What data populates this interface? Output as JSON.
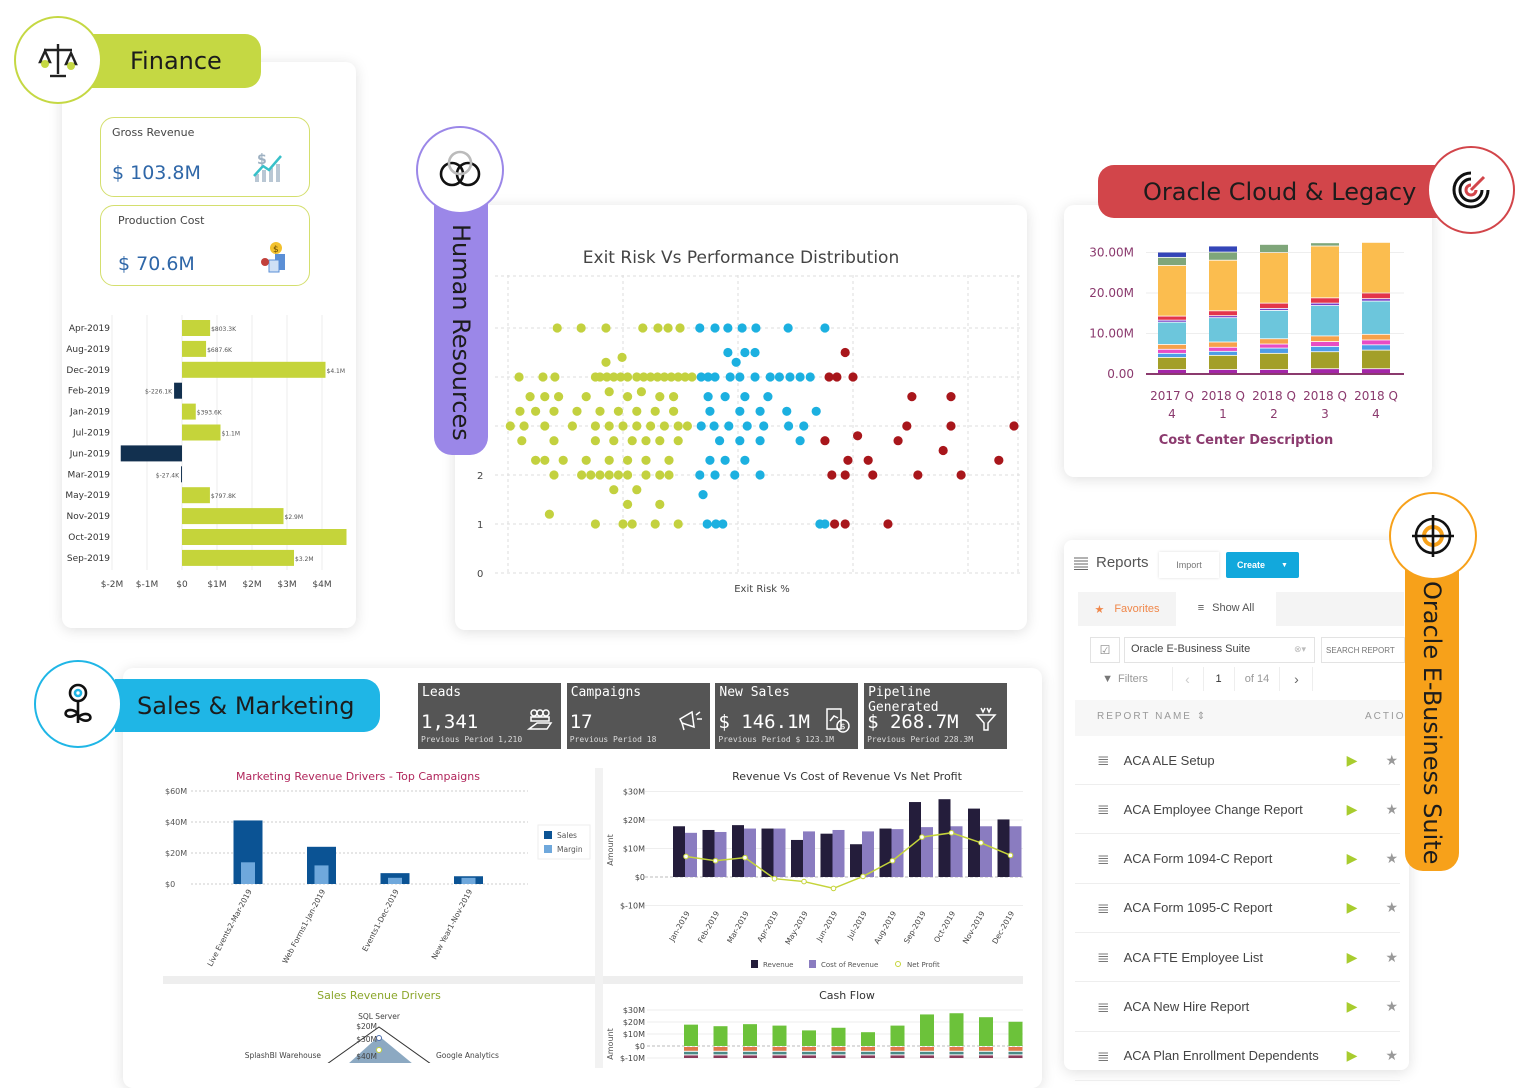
{
  "colors": {
    "finance": "#c5d843",
    "hr": "#9b87e8",
    "oracle_cloud": "#d2454a",
    "ebs": "#f7a11a",
    "sales": "#1fb6e6"
  },
  "finance": {
    "title": "Finance",
    "icon": "scales-icon",
    "kpis": [
      {
        "label": "Gross Revenue",
        "value": "$ 103.8M",
        "icon": "revenue-growth-icon"
      },
      {
        "label": "Production Cost",
        "value": "$ 70.6M",
        "icon": "production-cost-icon"
      }
    ],
    "chart_data": {
      "type": "bar",
      "orientation": "horizontal",
      "categories": [
        "Apr-2019",
        "Aug-2019",
        "Dec-2019",
        "Feb-2019",
        "Jan-2019",
        "Jul-2019",
        "Jun-2019",
        "Mar-2019",
        "May-2019",
        "Nov-2019",
        "Oct-2019",
        "Sep-2019"
      ],
      "values": [
        0.8033,
        0.6876,
        4.1,
        -0.2261,
        0.3936,
        1.1,
        -1.75,
        -0.0274,
        0.7978,
        2.9,
        4.7,
        3.2
      ],
      "labels": [
        "$803.3K",
        "$687.6K",
        "$4.1M",
        "$-226.1K",
        "$393.6K",
        "$1.1M",
        "",
        "$-27.4K",
        "$797.8K",
        "$2.9M",
        "",
        "$3.2M"
      ],
      "xticks": [
        "$-2M",
        "$-1M",
        "$0",
        "$1M",
        "$2M",
        "$3M",
        "$4M",
        "$"
      ],
      "xlim": [
        -2,
        4.8
      ],
      "unit": "$M",
      "positive_color": "#c5d43a",
      "negative_color": "#12304f"
    }
  },
  "hr": {
    "title": "Human Resources",
    "icon": "venn-circles-icon",
    "chart_data": {
      "type": "scatter",
      "title": "Exit Risk Vs Performance Distribution",
      "xlabel": "Exit Risk %",
      "ylabel": "",
      "ylim": [
        0,
        5
      ],
      "yticks": [
        "0",
        "1",
        "2"
      ],
      "xlim": [
        0,
        110
      ],
      "grid": true,
      "series": [
        {
          "color": "#c3d13f",
          "points": [
            [
              10.7,
              5
            ],
            [
              15.9,
              5
            ],
            [
              21.3,
              5
            ],
            [
              29.3,
              5
            ],
            [
              32.6,
              5
            ],
            [
              34.8,
              5
            ],
            [
              37.4,
              5
            ],
            [
              21.3,
              4.3
            ],
            [
              24.8,
              4.4
            ],
            [
              2.4,
              4
            ],
            [
              7.6,
              4
            ],
            [
              10.2,
              4
            ],
            [
              19,
              4
            ],
            [
              20,
              4
            ],
            [
              21.5,
              4
            ],
            [
              23,
              4
            ],
            [
              24.5,
              4
            ],
            [
              26,
              4
            ],
            [
              28,
              4
            ],
            [
              29.5,
              4
            ],
            [
              31,
              4
            ],
            [
              32.5,
              4
            ],
            [
              34,
              4
            ],
            [
              35.5,
              4
            ],
            [
              37,
              4
            ],
            [
              38.5,
              4
            ],
            [
              40,
              4
            ],
            [
              4.8,
              3.6
            ],
            [
              8,
              3.6
            ],
            [
              11,
              3.6
            ],
            [
              17,
              3.6
            ],
            [
              22,
              3.7
            ],
            [
              26,
              3.6
            ],
            [
              29,
              3.7
            ],
            [
              33,
              3.6
            ],
            [
              36,
              3.6
            ],
            [
              2.6,
              3.3
            ],
            [
              6,
              3.3
            ],
            [
              10,
              3.3
            ],
            [
              15,
              3.3
            ],
            [
              20,
              3.3
            ],
            [
              24,
              3.3
            ],
            [
              28,
              3.3
            ],
            [
              32,
              3.3
            ],
            [
              36,
              3.3
            ],
            [
              0.5,
              3
            ],
            [
              3.5,
              3
            ],
            [
              8,
              3
            ],
            [
              14,
              3
            ],
            [
              19,
              3
            ],
            [
              22,
              3
            ],
            [
              25,
              3
            ],
            [
              28,
              3
            ],
            [
              31,
              3
            ],
            [
              34,
              3
            ],
            [
              37,
              3
            ],
            [
              39,
              3
            ],
            [
              3,
              2.7
            ],
            [
              10,
              2.7
            ],
            [
              19,
              2.7
            ],
            [
              23,
              2.7
            ],
            [
              27,
              2.7
            ],
            [
              30,
              2.7
            ],
            [
              33,
              2.7
            ],
            [
              37,
              2.7
            ],
            [
              6,
              2.3
            ],
            [
              8,
              2.3
            ],
            [
              12,
              2.3
            ],
            [
              17,
              2.3
            ],
            [
              22,
              2.3
            ],
            [
              26,
              2.3
            ],
            [
              30,
              2.3
            ],
            [
              35,
              2.3
            ],
            [
              10,
              2
            ],
            [
              16,
              2
            ],
            [
              18,
              2
            ],
            [
              20,
              2
            ],
            [
              22,
              2
            ],
            [
              24,
              2
            ],
            [
              26,
              2
            ],
            [
              30,
              2
            ],
            [
              33,
              2
            ],
            [
              35,
              2
            ],
            [
              23,
              1.7
            ],
            [
              28,
              1.7
            ],
            [
              26,
              1.4
            ],
            [
              33,
              1.4
            ],
            [
              9,
              1.2
            ],
            [
              19,
              1
            ],
            [
              25,
              1
            ],
            [
              27,
              1
            ],
            [
              32,
              1
            ],
            [
              37,
              1
            ]
          ]
        },
        {
          "color": "#1cb0e0",
          "points": [
            [
              41.7,
              5
            ],
            [
              45,
              5
            ],
            [
              47.8,
              5
            ],
            [
              50.9,
              5
            ],
            [
              53.9,
              5
            ],
            [
              60.9,
              5
            ],
            [
              68.9,
              5
            ],
            [
              47.8,
              4.5
            ],
            [
              51.5,
              4.5
            ],
            [
              53.7,
              4.5
            ],
            [
              49.6,
              4.3
            ],
            [
              42,
              4
            ],
            [
              43.5,
              4
            ],
            [
              45,
              4
            ],
            [
              48.3,
              4
            ],
            [
              50.4,
              4
            ],
            [
              53.7,
              4
            ],
            [
              57,
              4
            ],
            [
              59,
              4
            ],
            [
              61.3,
              4
            ],
            [
              63.5,
              4
            ],
            [
              65.7,
              4
            ],
            [
              43.5,
              3.6
            ],
            [
              47.2,
              3.6
            ],
            [
              51.5,
              3.6
            ],
            [
              56.5,
              3.6
            ],
            [
              43.9,
              3.3
            ],
            [
              50.4,
              3.3
            ],
            [
              54.8,
              3.3
            ],
            [
              60.6,
              3.3
            ],
            [
              67,
              3.3
            ],
            [
              42,
              3
            ],
            [
              44.8,
              3
            ],
            [
              48,
              3
            ],
            [
              52,
              3
            ],
            [
              55.6,
              3
            ],
            [
              61,
              3
            ],
            [
              64.3,
              3
            ],
            [
              46,
              2.7
            ],
            [
              50.4,
              2.7
            ],
            [
              54.8,
              2.7
            ],
            [
              63.5,
              2.7
            ],
            [
              43.9,
              2.3
            ],
            [
              47.2,
              2.3
            ],
            [
              51.5,
              2.3
            ],
            [
              41.7,
              2
            ],
            [
              45,
              2
            ],
            [
              49.3,
              2
            ],
            [
              54.8,
              2
            ],
            [
              42.4,
              1.6
            ],
            [
              43.3,
              1
            ],
            [
              45.2,
              1
            ],
            [
              46.7,
              1
            ],
            [
              67.8,
              1
            ],
            [
              68.9,
              1
            ]
          ]
        },
        {
          "color": "#a8161b",
          "points": [
            [
              73.3,
              4.5
            ],
            [
              69.8,
              4
            ],
            [
              71.5,
              4
            ],
            [
              75,
              4
            ],
            [
              87.8,
              3.6
            ],
            [
              96.3,
              3.6
            ],
            [
              86.7,
              3
            ],
            [
              96.3,
              3
            ],
            [
              110,
              3
            ],
            [
              68.9,
              2.7
            ],
            [
              76,
              2.8
            ],
            [
              84.8,
              2.7
            ],
            [
              94.6,
              2.5
            ],
            [
              73.9,
              2.3
            ],
            [
              78.3,
              2.3
            ],
            [
              106.7,
              2.3
            ],
            [
              70.4,
              2
            ],
            [
              73.3,
              2
            ],
            [
              79.3,
              2
            ],
            [
              89.1,
              2
            ],
            [
              98.5,
              2
            ],
            [
              71,
              1
            ],
            [
              73.3,
              1
            ],
            [
              82.6,
              1
            ]
          ]
        }
      ]
    }
  },
  "oracle_cloud": {
    "title": "Oracle Cloud & Legacy",
    "icon": "spiral-target-icon",
    "chart_data": {
      "type": "bar",
      "stacked": true,
      "xlabel": "Cost Center Description",
      "yticks": [
        "0.00",
        "10.00M",
        "20.00M",
        "30.00M"
      ],
      "ylim": [
        0,
        33
      ],
      "categories": [
        [
          "2017 Q",
          "4"
        ],
        [
          "2018 Q",
          "1"
        ],
        [
          "2018 Q",
          "2"
        ],
        [
          "2018 Q",
          "3"
        ],
        [
          "2018 Q",
          "4"
        ]
      ],
      "colors": [
        "#a326a8",
        "#a39f28",
        "#4e9de8",
        "#e84cc4",
        "#f7a14a",
        "#6cc6dc",
        "#7a3fc6",
        "#e4354a",
        "#fbbd4f",
        "#7fa67a",
        "#3445b8"
      ],
      "stacks": [
        [
          1,
          3,
          1,
          1,
          1.2,
          5.5,
          0.5,
          1,
          12.5,
          2,
          1.3
        ],
        [
          1,
          3.5,
          1,
          1,
          1.3,
          6,
          0.5,
          1.2,
          12.5,
          2,
          1.5
        ],
        [
          1,
          4,
          1.3,
          1,
          1.3,
          7,
          0.5,
          1.3,
          12.5,
          2,
          0
        ],
        [
          1.2,
          4.2,
          1.3,
          1.2,
          1.4,
          7.5,
          0.6,
          1.3,
          12.8,
          0.8,
          0
        ],
        [
          1.2,
          4.6,
          1.3,
          1.2,
          1.4,
          8.2,
          0.6,
          1.4,
          12.5,
          0,
          0
        ]
      ]
    }
  },
  "ebs": {
    "title": "Oracle E-Business Suite",
    "icon": "globe-target-icon",
    "header": {
      "title": "Reports",
      "import": "Import",
      "create": "Create"
    },
    "tabs": {
      "favorites": "Favorites",
      "show_all": "Show All"
    },
    "filter": {
      "selected": "Oracle E-Business Suite",
      "search_placeholder": "SEARCH REPORT",
      "filters": "Filters",
      "page": "1",
      "of": "of 14"
    },
    "columns": {
      "name": "REPORT NAME",
      "actions": "ACTIO"
    },
    "reports": [
      "ACA ALE Setup",
      "ACA Employee Change Report",
      "ACA Form 1094-C Report",
      "ACA Form 1095-C Report",
      "ACA FTE Employee List",
      "ACA New Hire Report",
      "ACA Plan Enrollment Dependents"
    ]
  },
  "sales": {
    "title": "Sales & Marketing",
    "icon": "flower-pin-icon",
    "tiles": [
      {
        "label": "Leads",
        "value": "1,341",
        "previous": "Previous Period 1,210",
        "icon": "hand-group-icon"
      },
      {
        "label": "Campaigns",
        "value": "17",
        "previous": "Previous Period 18",
        "icon": "megaphone-icon"
      },
      {
        "label": "New Sales",
        "value": "$ 146.1M",
        "previous": "Previous Period $ 123.1M",
        "icon": "sales-doc-icon"
      },
      {
        "label": "Pipeline Generated",
        "value": "$ 268.7M",
        "previous": "Previous Period 228.3M",
        "icon": "funnel-icon"
      }
    ],
    "marketing_chart": {
      "type": "bar",
      "title": "Marketing Revenue Drivers - Top Campaigns",
      "yticks": [
        "$0",
        "$20M",
        "$40M",
        "$60M"
      ],
      "ylim": [
        0,
        60
      ],
      "categories": [
        "Live Events2-Mar-2019",
        "Web Forms1-Jan-2019",
        "Events1-Dec-2019",
        "New Year1-Nov-2019"
      ],
      "series": [
        {
          "name": "Sales",
          "values": [
            41,
            24,
            7,
            5
          ],
          "color": "#0b5394"
        },
        {
          "name": "Margin",
          "values": [
            14,
            12,
            4,
            4
          ],
          "color": "#6fa8dc"
        }
      ],
      "legend": "right"
    },
    "revenue_chart": {
      "type": "bar",
      "title": "Revenue Vs Cost of Revenue Vs Net Profit",
      "ylabel": "Amount",
      "yticks": [
        "$-10M",
        "$0",
        "$10M",
        "$20M",
        "$30M"
      ],
      "ylim": [
        -10,
        30
      ],
      "categories": [
        "Jan-2019",
        "Feb-2019",
        "Mar-2019",
        "Apr-2019",
        "May-2019",
        "Jun-2019",
        "Jul-2019",
        "Aug-2019",
        "Sep-2019",
        "Oct-2019",
        "Nov-2019",
        "Dec-2019"
      ],
      "series": [
        {
          "name": "Revenue",
          "values": [
            17.8,
            16.5,
            18.2,
            17,
            13,
            15.2,
            11.5,
            17,
            26.3,
            27.3,
            24,
            20.2
          ],
          "color": "#241d3b"
        },
        {
          "name": "Cost of Revenue",
          "values": [
            15.5,
            15.8,
            17,
            17,
            16,
            16.5,
            16,
            16.8,
            17.5,
            17.8,
            17.8,
            17.8
          ],
          "color": "#8a7cc0"
        },
        {
          "name": "Net Profit",
          "type": "line",
          "values": [
            7.2,
            5.7,
            6.8,
            -0.6,
            -1.6,
            -4,
            0.2,
            5.7,
            14,
            15.5,
            12,
            7.6
          ],
          "color": "#c5d43a"
        }
      ],
      "legend": "bottom"
    },
    "radar_chart": {
      "type": "radar",
      "title": "Sales Revenue Drivers",
      "axes": [
        "SQL Server",
        "Google Analytics",
        "SplashBI Warehouse"
      ],
      "ticks": [
        "$20M",
        "$30M",
        "$40M"
      ]
    },
    "cashflow_chart": {
      "type": "bar",
      "stacked": true,
      "title": "Cash Flow",
      "ylabel": "Amount",
      "yticks": [
        "$-10M",
        "$0",
        "$10M",
        "$20M",
        "$30M"
      ],
      "ylim": [
        -10,
        30
      ],
      "positive": [
        17.8,
        16.5,
        18.2,
        17,
        13,
        15.2,
        11.5,
        17,
        26.3,
        27.3,
        24,
        20.2
      ],
      "negative_colors": [
        "#e0774a",
        "#4a8a86",
        "#8b3b5b"
      ],
      "negative": [
        [
          -4,
          -3,
          -3
        ]
      ]
    }
  }
}
